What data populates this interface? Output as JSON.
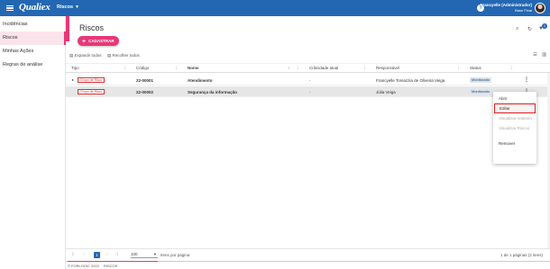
{
  "topbar": {
    "logo": "Qualiex",
    "module": "Riscos",
    "user_name": "Francyelle (Administrador)",
    "user_sub": "Base Final",
    "help_symbol": "?"
  },
  "sidebar": {
    "items": [
      {
        "label": "Incidências"
      },
      {
        "label": "Riscos"
      },
      {
        "label": "Minhas Ações"
      },
      {
        "label": "Regras de análise"
      }
    ]
  },
  "page": {
    "title": "Riscos",
    "add_button": "CADASTRAR",
    "notification_count": "1"
  },
  "toolbar": {
    "expand_all": "Expandir todos",
    "collapse_all": "Recolher todos"
  },
  "table": {
    "columns": {
      "tipo": "Tipo",
      "codigo": "Código",
      "nome": "Nome",
      "criticidade": "Criticidade atual",
      "responsavel": "Responsável",
      "status": "Status"
    },
    "rows": [
      {
        "tipo": "Grupo de Risco",
        "codigo": "22-00001",
        "nome": "Atendimento",
        "criticidade": "-",
        "responsavel": "Francyelle Tomazzia de Oliveira Veiga",
        "status": "Monitorado"
      },
      {
        "tipo": "Grupo de Risco",
        "codigo": "22-00002",
        "nome": "Segurança da informação",
        "criticidade": "-",
        "responsavel": "Júlia Veiga",
        "status": "Monitorado"
      }
    ]
  },
  "row_menu": {
    "items": [
      {
        "label": "Abrir",
        "enabled": true
      },
      {
        "label": "Editar",
        "enabled": true
      },
      {
        "label": "Visualizar relatório",
        "enabled": false
      },
      {
        "label": "Visualizar Riscos",
        "enabled": false
      },
      {
        "label": "Remover",
        "enabled": true
      }
    ]
  },
  "pagination": {
    "current_page": "1",
    "page_size": "100",
    "items_per_page_label": "Itens por página",
    "info": "1 de 1 páginas (2 itens)"
  },
  "footer": {
    "copyright": "© FORLOGIC 2022",
    "page_name": "RISCOS"
  },
  "colors": {
    "primary_blue": "#2367b3",
    "accent_pink": "#e73878",
    "status_bg": "#d7e4f0",
    "tag_red": "#dd3333"
  }
}
